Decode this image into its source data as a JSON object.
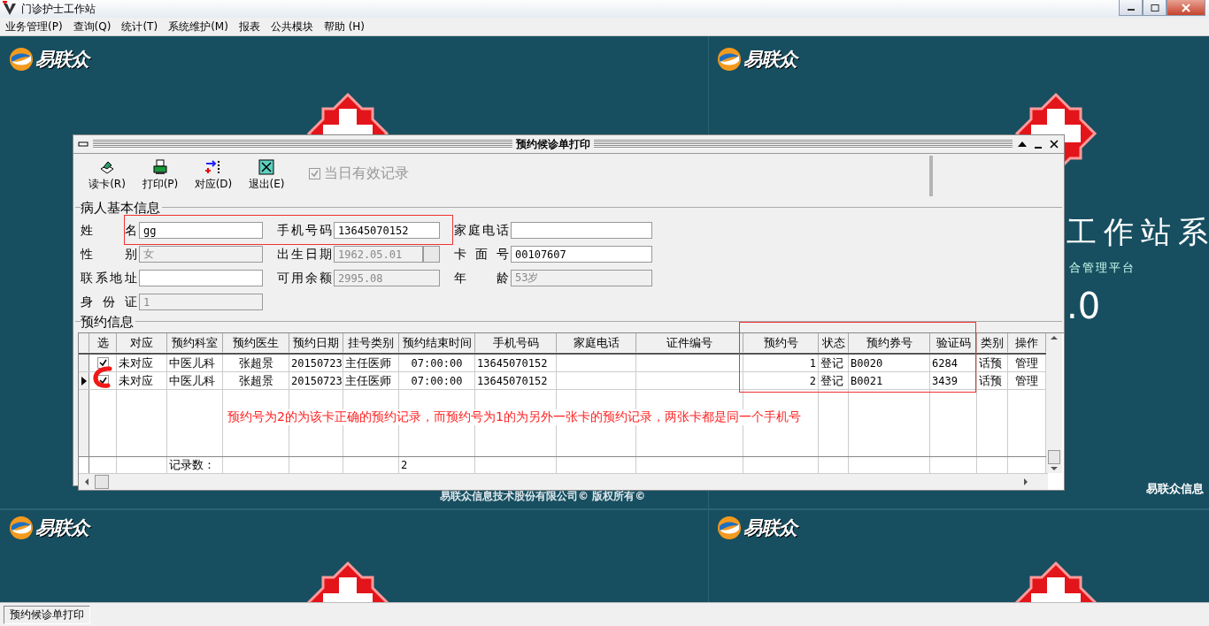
{
  "window": {
    "title": "门诊护士工作站"
  },
  "menu": [
    "业务管理(P)",
    "查询(Q)",
    "统计(T)",
    "系统维护(M)",
    "报表",
    "公共模块",
    "帮助 (H)"
  ],
  "wallpaper": {
    "logos": [
      "易联众",
      "易联众",
      "易联众",
      "易联众"
    ],
    "title_fragment": "工作站系",
    "subtitle_fragment": "合管理平台",
    "version_fragment": ".0",
    "copyright": "易联众信息技术股份有限公司© 版权所有©",
    "company_fragment": "易联众信息"
  },
  "dialog": {
    "title": "预约候诊单打印",
    "toolbar": [
      {
        "kind": "card",
        "label": "读卡(R)"
      },
      {
        "kind": "print",
        "label": "打印(P)"
      },
      {
        "kind": "match",
        "label": "对应(D)"
      },
      {
        "kind": "exit",
        "label": "退出(E)"
      }
    ],
    "valid_today": {
      "label": "当日有效记录",
      "checked": true,
      "disabled": true
    },
    "patient": {
      "legend": "病人基本信息",
      "fields": [
        {
          "label": "姓名",
          "value": "gg",
          "disabled": false
        },
        {
          "label": "手机号码",
          "value": "13645070152",
          "disabled": false
        },
        {
          "label": "家庭电话",
          "disabled": false
        },
        {
          "label": "性别",
          "value": "女",
          "disabled": true
        },
        {
          "label": "出生日期",
          "value": "1962.05.01",
          "disabled": true,
          "kind": "date"
        },
        {
          "label": "卡面号",
          "value": "00107607",
          "disabled": false
        },
        {
          "label": "联系地址",
          "disabled": false
        },
        {
          "label": "可用余额",
          "value": "2995.08",
          "disabled": true
        },
        {
          "label": "年龄",
          "value": "53岁",
          "disabled": true
        },
        {
          "label": "身份证",
          "value": "1",
          "disabled": true
        }
      ]
    },
    "appointments": {
      "legend": "预约信息",
      "select_column": "选",
      "columns": [
        "对应",
        "预约科室",
        "预约医生",
        "预约日期",
        "挂号类别",
        "预约结束时间",
        "手机号码",
        "家庭电话",
        "证件编号",
        "预约号",
        "状态",
        "预约券号",
        "验证码",
        "类别",
        "操作"
      ],
      "rows": [
        {
          "checked": true,
          "current": false,
          "cells": [
            "未对应",
            "中医儿科",
            "张超景",
            "20150723",
            "主任医师",
            "07:00:00",
            "13645070152",
            null,
            null,
            "1",
            "登记",
            "B0020",
            "6284",
            "话预",
            "管理"
          ]
        },
        {
          "checked": true,
          "current": true,
          "cells": [
            "未对应",
            "中医儿科",
            "张超景",
            "20150723",
            "主任医师",
            "07:00:00",
            "13645070152",
            null,
            null,
            "2",
            "登记",
            "B0021",
            "3439",
            "话预",
            "管理"
          ]
        }
      ],
      "footer": {
        "label": "记录数：",
        "count": "2"
      },
      "note": "预约号为2的为该卡正确的预约记录，而预约号为1的为另外一张卡的预约记录，两张卡都是同一个手机号"
    }
  },
  "status_bar": {
    "tabs": [
      "预约候诊单打印"
    ]
  }
}
